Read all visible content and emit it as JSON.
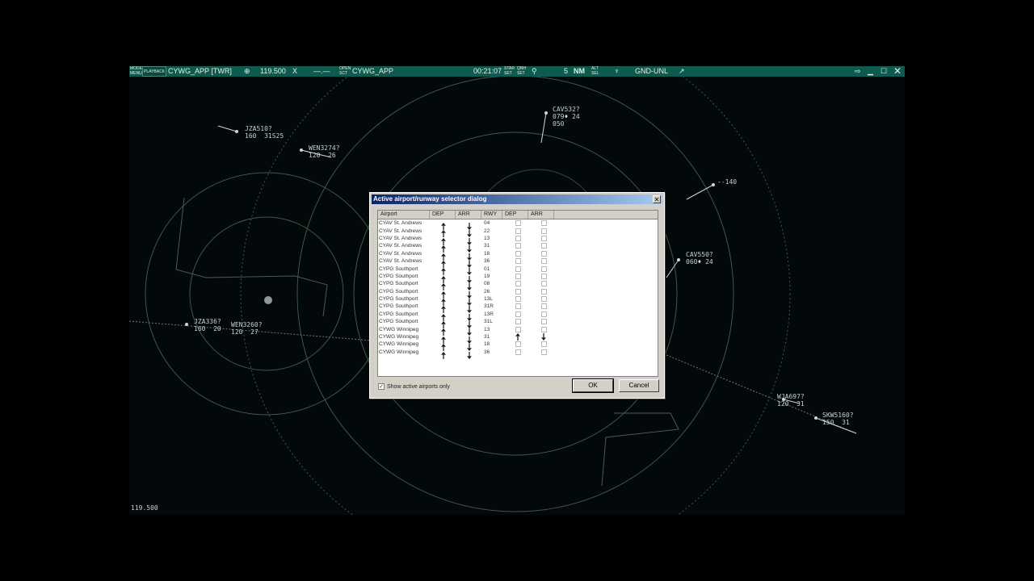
{
  "toolbar": {
    "menu_small": [
      "MODE",
      "MENU"
    ],
    "playback": "PLAYBACK",
    "position": "CYWG_APP [TWR]",
    "frequency": "119.500",
    "x_label": "X",
    "dash": "—.—",
    "open_sct_small": [
      "OPEN",
      "SCT"
    ],
    "sector": "CYWG_APP",
    "time": "00:21:07",
    "set1_small": [
      "STAR",
      "SET"
    ],
    "set2_small": [
      "QNH",
      "SET"
    ],
    "range": "5",
    "range_unit": "NM",
    "alt_small": [
      "ALT",
      "SEL"
    ],
    "filter": "GND-UNL"
  },
  "radar": {
    "targets": [
      {
        "cs": "JZA510?",
        "data": "160  31S25"
      },
      {
        "cs": "WEN3274?",
        "data": "120  26"
      },
      {
        "cs": "CAV532?",
        "data": "079♦ 24\n050"
      },
      {
        "cs": "--140",
        "data": ""
      },
      {
        "cs": "CAV550?",
        "data": "060♦ 24"
      },
      {
        "cs": "JZA336?",
        "data": "160  20"
      },
      {
        "cs": "WEN3260?",
        "data": "120  27"
      },
      {
        "cs": "WJA697?",
        "data": "120  31"
      },
      {
        "cs": "SKW5160?",
        "data": "150  31"
      }
    ],
    "frequency_readout": "119.500"
  },
  "dialog": {
    "title": "Active airport/runway selector dialog",
    "columns": [
      "Airport",
      "DEP",
      "ARR",
      "RWY",
      "DEP",
      "ARR"
    ],
    "rows": [
      {
        "airport": "CYAV St. Andrews",
        "rwy": "04"
      },
      {
        "airport": "CYAV St. Andrews",
        "rwy": "22"
      },
      {
        "airport": "CYAV St. Andrews",
        "rwy": "13"
      },
      {
        "airport": "CYAV St. Andrews",
        "rwy": "31"
      },
      {
        "airport": "CYAV St. Andrews",
        "rwy": "18"
      },
      {
        "airport": "CYAV St. Andrews",
        "rwy": "36"
      },
      {
        "airport": "CYPG Southport",
        "rwy": "01"
      },
      {
        "airport": "CYPG Southport",
        "rwy": "19"
      },
      {
        "airport": "CYPG Southport",
        "rwy": "08"
      },
      {
        "airport": "CYPG Southport",
        "rwy": "26"
      },
      {
        "airport": "CYPG Southport",
        "rwy": "13L"
      },
      {
        "airport": "CYPG Southport",
        "rwy": "31R"
      },
      {
        "airport": "CYPG Southport",
        "rwy": "13R"
      },
      {
        "airport": "CYPG Southport",
        "rwy": "31L"
      },
      {
        "airport": "CYWG Winnipeg",
        "rwy": "13"
      },
      {
        "airport": "CYWG Winnipeg",
        "rwy": "31",
        "dep_active": true,
        "arr_active": true
      },
      {
        "airport": "CYWG Winnipeg",
        "rwy": "18"
      },
      {
        "airport": "CYWG Winnipeg",
        "rwy": "36"
      }
    ],
    "show_active_label": "Show active airports only",
    "show_active_checked": true,
    "ok_label": "OK",
    "cancel_label": "Cancel"
  }
}
